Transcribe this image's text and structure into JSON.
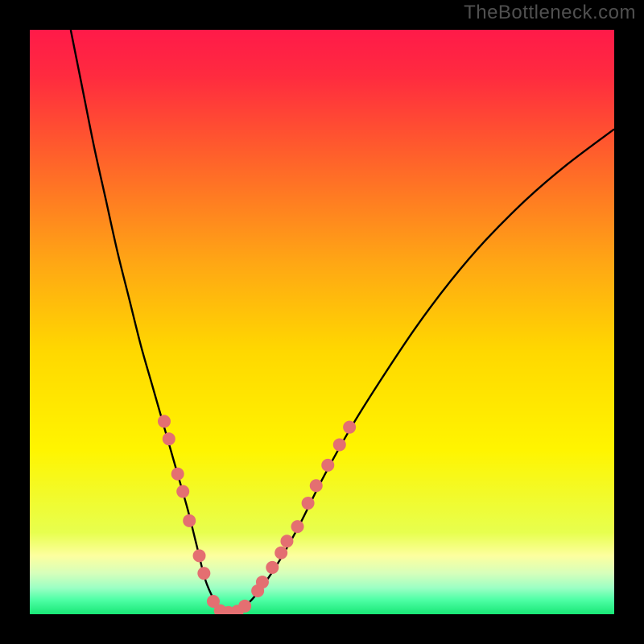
{
  "watermark": "TheBottleneck.com",
  "chart_data": {
    "type": "line",
    "title": "",
    "xlabel": "",
    "ylabel": "",
    "xlim": [
      0,
      100
    ],
    "ylim": [
      0,
      100
    ],
    "background_gradient": {
      "stops": [
        {
          "pos": 0.0,
          "color": "#ff1a49"
        },
        {
          "pos": 0.08,
          "color": "#ff2b3f"
        },
        {
          "pos": 0.2,
          "color": "#ff5a2d"
        },
        {
          "pos": 0.4,
          "color": "#ffa714"
        },
        {
          "pos": 0.55,
          "color": "#ffd800"
        },
        {
          "pos": 0.72,
          "color": "#fff500"
        },
        {
          "pos": 0.86,
          "color": "#e7ff4e"
        },
        {
          "pos": 0.9,
          "color": "#fdff9f"
        },
        {
          "pos": 0.93,
          "color": "#d6ffbb"
        },
        {
          "pos": 0.955,
          "color": "#9bffc4"
        },
        {
          "pos": 0.975,
          "color": "#4fffa6"
        },
        {
          "pos": 1.0,
          "color": "#18e776"
        }
      ]
    },
    "series": [
      {
        "name": "bottleneck-curve",
        "color": "#000000",
        "x": [
          7,
          9,
          11,
          13,
          15,
          17,
          19,
          21,
          23,
          25,
          27,
          28.5,
          30,
          31.5,
          33,
          35,
          38,
          42,
          46,
          50,
          55,
          60,
          66,
          72,
          78,
          85,
          92,
          100
        ],
        "y": [
          100,
          90,
          80,
          71,
          62,
          54,
          46,
          39,
          32,
          25,
          18,
          12,
          6,
          2.5,
          0.2,
          0.2,
          2.5,
          8,
          15,
          23,
          32,
          40,
          49,
          57,
          64,
          71,
          77,
          83
        ]
      }
    ],
    "markers": {
      "name": "highlight-dots",
      "color": "#e46f71",
      "radius": 8,
      "points": [
        {
          "x": 23.0,
          "y": 33
        },
        {
          "x": 23.8,
          "y": 30
        },
        {
          "x": 25.3,
          "y": 24
        },
        {
          "x": 26.2,
          "y": 21
        },
        {
          "x": 27.3,
          "y": 16
        },
        {
          "x": 29.0,
          "y": 10
        },
        {
          "x": 29.8,
          "y": 7
        },
        {
          "x": 31.4,
          "y": 2.2
        },
        {
          "x": 32.6,
          "y": 0.6
        },
        {
          "x": 34.0,
          "y": 0.3
        },
        {
          "x": 35.5,
          "y": 0.5
        },
        {
          "x": 36.8,
          "y": 1.4
        },
        {
          "x": 39.0,
          "y": 4
        },
        {
          "x": 39.8,
          "y": 5.5
        },
        {
          "x": 41.5,
          "y": 8
        },
        {
          "x": 43.0,
          "y": 10.5
        },
        {
          "x": 44.0,
          "y": 12.5
        },
        {
          "x": 45.8,
          "y": 15
        },
        {
          "x": 47.6,
          "y": 19
        },
        {
          "x": 49.0,
          "y": 22
        },
        {
          "x": 51.0,
          "y": 25.5
        },
        {
          "x": 53.0,
          "y": 29
        },
        {
          "x": 54.7,
          "y": 32
        }
      ]
    }
  }
}
